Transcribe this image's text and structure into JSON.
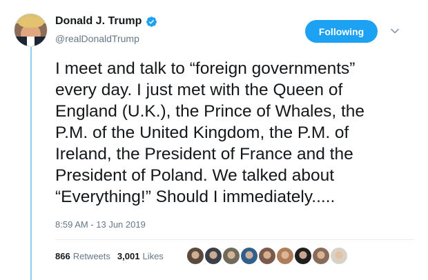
{
  "author": {
    "display_name": "Donald J. Trump",
    "handle": "@realDonaldTrump",
    "verified_icon": "verified-badge-icon"
  },
  "follow_button": {
    "label": "Following",
    "color": "#1da1f2"
  },
  "tweet": {
    "lines": [
      "I meet and talk to “foreign governments”",
      "every day. I just met with the Queen of",
      "England (U.K.), the Prince of Whales, the",
      "P.M. of the United Kingdom, the P.M. of",
      "Ireland, the President of France and the",
      "President of Poland. We talked about",
      "“Everything!” Should I immediately....."
    ],
    "timestamp": "8:59 AM - 13 Jun 2019"
  },
  "stats": {
    "retweets_count": "866",
    "retweets_label": "Retweets",
    "likes_count": "3,001",
    "likes_label": "Likes"
  },
  "liker_avatars": [
    {
      "color": "#5a4a3e"
    },
    {
      "color": "#3b3f48"
    },
    {
      "color": "#6e6a5c"
    },
    {
      "color": "#2f5f8a"
    },
    {
      "color": "#7a5b4b"
    },
    {
      "color": "#b07d5a"
    },
    {
      "color": "#1f1f1f"
    },
    {
      "color": "#8a6a58"
    },
    {
      "color": "#d8d2c6"
    }
  ]
}
